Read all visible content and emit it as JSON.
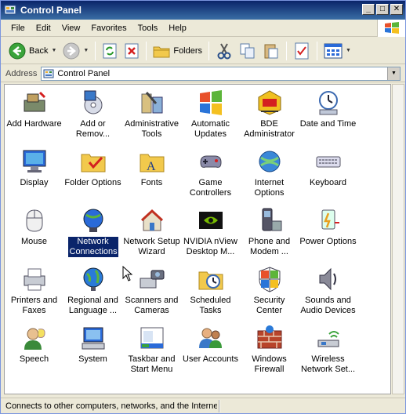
{
  "window": {
    "title": "Control Panel",
    "controls": {
      "minimize": "_",
      "maximize": "□",
      "close": "✕"
    }
  },
  "menubar": {
    "items": [
      "File",
      "Edit",
      "View",
      "Favorites",
      "Tools",
      "Help"
    ]
  },
  "toolbar": {
    "back_label": "Back",
    "folders_label": "Folders"
  },
  "address": {
    "label": "Address",
    "value": "Control Panel"
  },
  "items": [
    {
      "label": "Add Hardware",
      "icon": "add-hardware-icon"
    },
    {
      "label": "Add or\nRemov...",
      "icon": "add-remove-programs-icon"
    },
    {
      "label": "Administrative\nTools",
      "icon": "administrative-tools-icon"
    },
    {
      "label": "Automatic\nUpdates",
      "icon": "automatic-updates-icon"
    },
    {
      "label": "BDE\nAdministrator",
      "icon": "bde-administrator-icon"
    },
    {
      "label": "Date and Time",
      "icon": "date-time-icon"
    },
    {
      "label": "Display",
      "icon": "display-icon"
    },
    {
      "label": "Folder Options",
      "icon": "folder-options-icon"
    },
    {
      "label": "Fonts",
      "icon": "fonts-icon"
    },
    {
      "label": "Game\nControllers",
      "icon": "game-controllers-icon"
    },
    {
      "label": "Internet\nOptions",
      "icon": "internet-options-icon"
    },
    {
      "label": "Keyboard",
      "icon": "keyboard-icon"
    },
    {
      "label": "Mouse",
      "icon": "mouse-icon"
    },
    {
      "label": "Network\nConnections",
      "icon": "network-connections-icon",
      "selected": true
    },
    {
      "label": "Network Setup\nWizard",
      "icon": "network-setup-wizard-icon"
    },
    {
      "label": "NVIDIA nView\nDesktop M...",
      "icon": "nvidia-nview-icon"
    },
    {
      "label": "Phone and\nModem ...",
      "icon": "phone-modem-icon"
    },
    {
      "label": "Power Options",
      "icon": "power-options-icon"
    },
    {
      "label": "Printers and\nFaxes",
      "icon": "printers-faxes-icon"
    },
    {
      "label": "Regional and\nLanguage ...",
      "icon": "regional-language-icon"
    },
    {
      "label": "Scanners and\nCameras",
      "icon": "scanners-cameras-icon"
    },
    {
      "label": "Scheduled\nTasks",
      "icon": "scheduled-tasks-icon"
    },
    {
      "label": "Security\nCenter",
      "icon": "security-center-icon"
    },
    {
      "label": "Sounds and\nAudio Devices",
      "icon": "sounds-audio-icon"
    },
    {
      "label": "Speech",
      "icon": "speech-icon"
    },
    {
      "label": "System",
      "icon": "system-icon"
    },
    {
      "label": "Taskbar and\nStart Menu",
      "icon": "taskbar-start-menu-icon"
    },
    {
      "label": "User Accounts",
      "icon": "user-accounts-icon"
    },
    {
      "label": "Windows\nFirewall",
      "icon": "windows-firewall-icon"
    },
    {
      "label": "Wireless\nNetwork Set...",
      "icon": "wireless-network-setup-icon"
    }
  ],
  "status": {
    "text": "Connects to other computers, networks, and the Interne"
  },
  "colors": {
    "titlebar": "#0a246a",
    "selection": "#0a246a",
    "background": "#ece9d8"
  }
}
